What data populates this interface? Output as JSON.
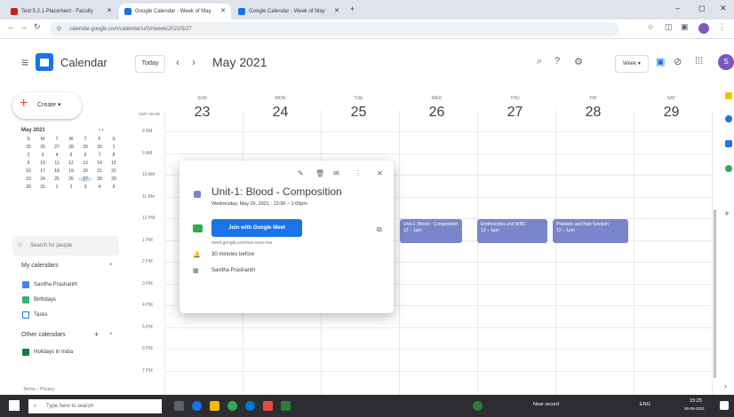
{
  "browser": {
    "tabs": [
      {
        "label": "Test 5.2.1 Placement - Faculty",
        "color": "#c5221f"
      },
      {
        "label": "Google Calendar - Week of May",
        "color": "#1a73e8"
      },
      {
        "label": "Google Calendar - Week of May",
        "color": "#1a73e8"
      }
    ],
    "url": "calendar.google.com/calendar/u/0/r/week/2021/5/27",
    "new_tab": "+",
    "window_min": "–",
    "window_restore": "◻",
    "window_close": "✕"
  },
  "header": {
    "brand": "Calendar",
    "today_btn": "Today",
    "prev": "‹",
    "next": "›",
    "month": "May 2021",
    "view_btn": "Week ▾",
    "avatar": "S"
  },
  "sidebar": {
    "create": "Create ▾",
    "mini_title": "May 2021",
    "mini_nav": "‹  ›",
    "weekday_letters": [
      "S",
      "M",
      "T",
      "W",
      "T",
      "F",
      "S"
    ],
    "mini_days": [
      "25",
      "26",
      "27",
      "28",
      "29",
      "30",
      "1",
      "2",
      "3",
      "4",
      "5",
      "6",
      "7",
      "8",
      "9",
      "10",
      "11",
      "12",
      "13",
      "14",
      "15",
      "16",
      "17",
      "18",
      "19",
      "20",
      "21",
      "22",
      "23",
      "24",
      "25",
      "26",
      "27",
      "28",
      "29",
      "30",
      "31",
      "1",
      "2",
      "3",
      "4",
      "5"
    ],
    "search_people": "Search for people",
    "my_calendars": "My calendars",
    "my_calendars_items": [
      {
        "label": "Savitha Prashanth",
        "color": "#4285f4",
        "checked": true
      },
      {
        "label": "Birthdays",
        "color": "#33b679",
        "checked": true
      },
      {
        "label": "Tasks",
        "color": "#ffffff",
        "checked": false
      }
    ],
    "other_calendars": "Other calendars",
    "other_calendars_items": [
      {
        "label": "Holidays in India",
        "color": "#0b8043",
        "checked": true
      }
    ],
    "terms": "Terms – Privacy"
  },
  "week": {
    "timezone": "GMT+05:30",
    "days": [
      {
        "name": "Sun",
        "num": "23"
      },
      {
        "name": "Mon",
        "num": "24"
      },
      {
        "name": "Tue",
        "num": "25"
      },
      {
        "name": "Wed",
        "num": "26"
      },
      {
        "name": "Thu",
        "num": "27"
      },
      {
        "name": "Fri",
        "num": "28"
      },
      {
        "name": "Sat",
        "num": "29"
      }
    ],
    "times": [
      "8 AM",
      "9 AM",
      "10 AM",
      "11 AM",
      "12 PM",
      "1 PM",
      "2 PM",
      "3 PM",
      "4 PM",
      "5 PM",
      "6 PM",
      "7 PM"
    ],
    "events": [
      {
        "title": "Unit-1: Blood - Composition",
        "time": "12 – 1pm"
      },
      {
        "title": "Erythrocytes and WBC",
        "time": "12 – 1pm"
      },
      {
        "title": "Platelets and their function",
        "time": "12 – 1pm"
      }
    ]
  },
  "popup": {
    "title": "Unit-1: Blood - Composition",
    "datetime": "Wednesday, May 26, 2021 ⋅ 12:00 – 1:00pm",
    "meet_btn": "Join with Google Meet",
    "meet_url": "meet.google.com/xxx-xxxx-xxx",
    "reminder": "30 minutes before",
    "organizer": "Savitha Prashanth",
    "actions": [
      "✎",
      "🗑",
      "✉",
      "⋮",
      "✕"
    ]
  },
  "taskbar": {
    "search": "Type here to search",
    "weather": "Near record",
    "lang": "ENG",
    "time": "15:25",
    "date": "26-05-2021"
  }
}
